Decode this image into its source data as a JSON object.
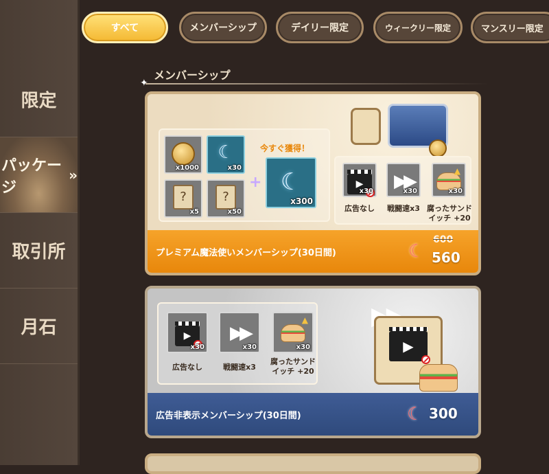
{
  "sidebar": {
    "items": [
      {
        "label": "限定"
      },
      {
        "label": "パッケージ",
        "active": true
      },
      {
        "label": "取引所"
      },
      {
        "label": "月石"
      }
    ]
  },
  "tabs": [
    {
      "label": "すべて",
      "active": true
    },
    {
      "label": "メンバーシップ"
    },
    {
      "label": "デイリー限定"
    },
    {
      "label": "ウィークリー限定"
    },
    {
      "label": "マンスリー限定"
    }
  ],
  "section": {
    "title": "メンバーシップ"
  },
  "card1": {
    "rewards": [
      {
        "icon": "gold-coin-icon",
        "qty": "x1000"
      },
      {
        "icon": "moonstone-icon",
        "qty": "x30"
      },
      {
        "icon": "mystery-scroll-icon",
        "qty": "x5"
      },
      {
        "icon": "mystery-scroll-icon",
        "qty": "x50"
      }
    ],
    "instant_label": "今すぐ獲得！",
    "instant_qty": "x300",
    "perks": [
      {
        "icon": "no-ads-icon",
        "qty": "x30",
        "label": "広告なし"
      },
      {
        "icon": "fast-forward-icon",
        "qty": "x30",
        "label": "戦闘速x3"
      },
      {
        "icon": "sandwich-icon",
        "qty": "x30",
        "label": "腐ったサンド\nイッチ +20"
      }
    ],
    "name": "プレミアム魔法使いメンバーシップ(30日間)",
    "old_price": "600",
    "price": "560",
    "accent": "#e8870b"
  },
  "card2": {
    "perks": [
      {
        "icon": "no-ads-icon",
        "qty": "x30",
        "label": "広告なし"
      },
      {
        "icon": "fast-forward-icon",
        "qty": "x30",
        "label": "戦闘速x3"
      },
      {
        "icon": "sandwich-icon",
        "qty": "x30",
        "label": "腐ったサンド\nイッチ +20"
      }
    ],
    "name": "広告非表示メンバーシップ(30日間)",
    "price": "300",
    "accent": "#2f4a7c"
  }
}
